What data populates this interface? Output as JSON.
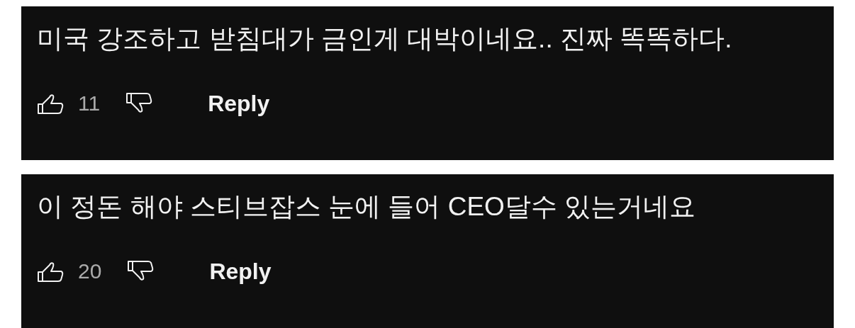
{
  "comments": [
    {
      "text": "미국 강조하고 받침대가 금인게 대박이네요.. 진짜 똑똑하다.",
      "likes": "11",
      "reply": "Reply"
    },
    {
      "text": "이 정돈 해야 스티브잡스 눈에 들어 CEO달수 있는거네요",
      "likes": "20",
      "reply": "Reply"
    }
  ]
}
